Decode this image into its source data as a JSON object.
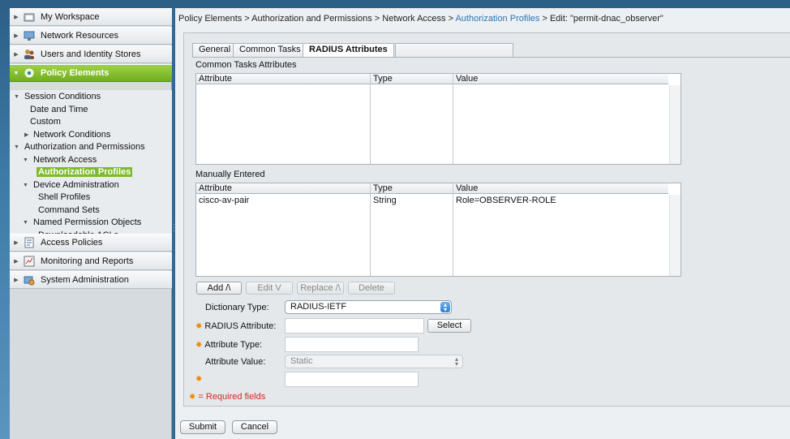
{
  "nav": {
    "sections": [
      {
        "label": "My Workspace",
        "icon": "workspace-icon"
      },
      {
        "label": "Network Resources",
        "icon": "network-resources-icon"
      },
      {
        "label": "Users and Identity Stores",
        "icon": "users-icon"
      },
      {
        "label": "Policy Elements",
        "icon": "policy-elements-icon"
      },
      {
        "label": "Access Policies",
        "icon": "access-policies-icon"
      },
      {
        "label": "Monitoring and Reports",
        "icon": "monitoring-icon"
      },
      {
        "label": "System Administration",
        "icon": "system-admin-icon"
      }
    ],
    "tree": [
      {
        "label": "Session Conditions"
      },
      {
        "label": "Date and Time"
      },
      {
        "label": "Custom"
      },
      {
        "label": "Network Conditions"
      },
      {
        "label": "Authorization and Permissions"
      },
      {
        "label": "Network Access"
      },
      {
        "label": "Authorization Profiles"
      },
      {
        "label": "Device Administration"
      },
      {
        "label": "Shell Profiles"
      },
      {
        "label": "Command Sets"
      },
      {
        "label": "Named Permission Objects"
      },
      {
        "label": "Downloadable ACLs"
      }
    ]
  },
  "breadcrumb": {
    "part1": "Policy Elements > Authorization and Permissions  > Network Access > ",
    "link": "Authorization Profiles",
    "part2": " > Edit: \"permit-dnac_observer\""
  },
  "tabs": [
    "General",
    "Common Tasks",
    "RADIUS Attributes"
  ],
  "common_tasks": {
    "title": "Common Tasks Attributes",
    "columns": [
      "Attribute",
      "Type",
      "Value"
    ]
  },
  "manual": {
    "title": "Manually Entered",
    "columns": [
      "Attribute",
      "Type",
      "Value"
    ],
    "rows": [
      {
        "attribute": "cisco-av-pair",
        "type": "String",
        "value": "Role=OBSERVER-ROLE"
      }
    ]
  },
  "row_buttons": {
    "add": "Add /\\",
    "edit": "Edit V",
    "replace": "Replace /\\",
    "delete": "Delete"
  },
  "form": {
    "dictionary_type_label": "Dictionary Type:",
    "dictionary_type_value": "RADIUS-IETF",
    "radius_attribute_label": "RADIUS Attribute:",
    "select_button": "Select",
    "attribute_type_label": "Attribute Type:",
    "attribute_value_label": "Attribute Value:",
    "attribute_value_select": "Static",
    "required_note": "= Required fields"
  },
  "footer": {
    "submit": "Submit",
    "cancel": "Cancel"
  },
  "colors": {
    "active_green": "#7dbb2a",
    "link_blue": "#2a76b8",
    "required_orange": "#f08c00"
  }
}
